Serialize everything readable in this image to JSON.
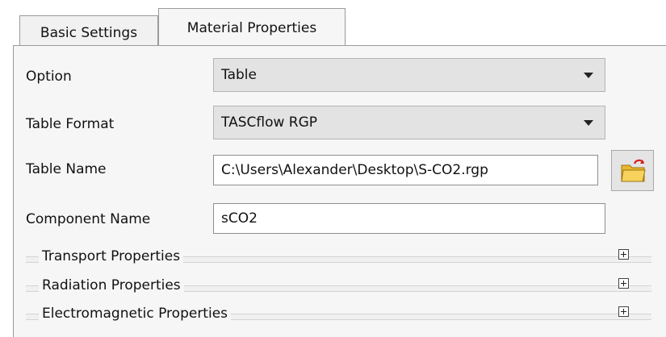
{
  "tabs": [
    {
      "label": "Basic Settings",
      "active": false
    },
    {
      "label": "Material Properties",
      "active": true
    }
  ],
  "form": {
    "option": {
      "label": "Option",
      "value": "Table"
    },
    "table_format": {
      "label": "Table Format",
      "value": "TASCflow RGP"
    },
    "table_name": {
      "label": "Table Name",
      "value": "C:\\Users\\Alexander\\Desktop\\S-CO2.rgp",
      "browse_icon": "folder-open-icon"
    },
    "component_name": {
      "label": "Component Name",
      "value": "sCO2"
    }
  },
  "groups": [
    {
      "title": "Transport Properties",
      "expand_icon": "plus-box-icon"
    },
    {
      "title": "Radiation Properties",
      "expand_icon": "plus-box-icon"
    },
    {
      "title": "Electromagnetic Properties",
      "expand_icon": "plus-box-icon"
    }
  ],
  "colors": {
    "panel": "#f6f6f6",
    "combo": "#e3e3e3",
    "folder": "#f2c23a"
  }
}
